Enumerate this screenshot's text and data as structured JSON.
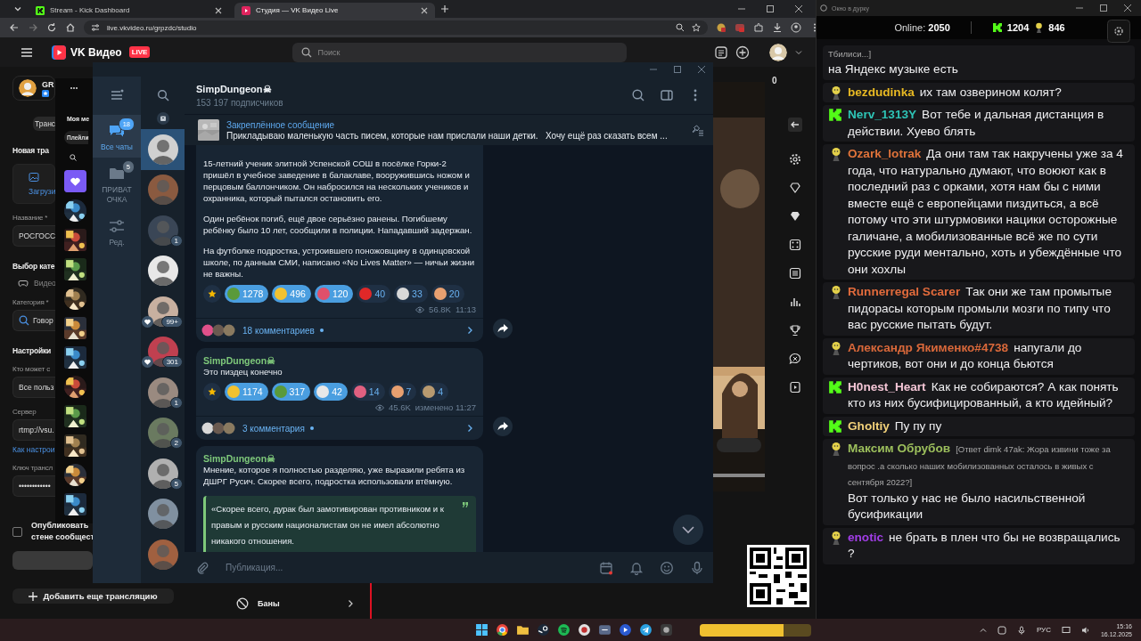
{
  "browser": {
    "tabs": [
      {
        "label": "Stream - Kick Dashboard",
        "selected": false
      },
      {
        "label": "Студия — VK Видео Live",
        "selected": true
      }
    ],
    "url": "live.vkvideo.ru/grpzdc/studio",
    "brand": "VK Видео",
    "brand_badge": "LIVE",
    "search_placeholder": "Поиск"
  },
  "studio": {
    "channel": "GR",
    "tab": "Транс",
    "heading": "Новая тра",
    "upload": "Загрузи",
    "title_label": "Название *",
    "title_value": "РОСГОСС",
    "category_heading": "Выбор кате",
    "category_type": "Видео",
    "category_label": "Категория *",
    "category_value": "Говор",
    "settings_heading": "Настройки",
    "access_label": "Кто может с",
    "access_value": "Все польз",
    "server_label": "Сервер",
    "server_value": "rtmp://vsu.",
    "help_link": "Как настрои",
    "key_label": "Ключ трансл",
    "key_value": "••••••••••••",
    "publish": {
      "lines": [
        "Опубликовать",
        "стене сообщест"
      ],
      "checked": false
    },
    "add_stream": "Добавить еще трансляцию",
    "bans": "Баны"
  },
  "music": {
    "heading": "Моя ме",
    "filter": "Плейли",
    "covers": [
      {
        "kind": "favorites"
      },
      {
        "kind": "picture"
      },
      {
        "kind": "picture"
      },
      {
        "kind": "picture"
      },
      {
        "kind": "picture"
      },
      {
        "kind": "picture"
      },
      {
        "kind": "picture"
      },
      {
        "kind": "picture"
      },
      {
        "kind": "picture"
      },
      {
        "kind": "picture"
      },
      {
        "kind": "picture"
      },
      {
        "kind": "picture"
      }
    ]
  },
  "side_rail": {
    "count": "0"
  },
  "telegram": {
    "channel": "SimpDungeon☠",
    "subscribers": "153 197 подписчиков",
    "folders": [
      {
        "kind": "folder",
        "label": "Все чаты",
        "badge": "18",
        "selected": true
      },
      {
        "kind": "folder",
        "label": "ПРИВАТ ОЧКА",
        "badge": "5",
        "selected": false
      },
      {
        "kind": "edit",
        "label": "Ред.",
        "selected": false
      }
    ],
    "chats": [
      {
        "selected": true,
        "reaction": false
      },
      {
        "selected": false,
        "reaction": false
      },
      {
        "selected": false,
        "reaction": false,
        "badge": "1"
      },
      {
        "selected": false,
        "reaction": false
      },
      {
        "selected": false,
        "reaction": true,
        "badge": "99+"
      },
      {
        "selected": false,
        "reaction": true,
        "badge": "301"
      },
      {
        "selected": false,
        "reaction": false,
        "badge": "1"
      },
      {
        "selected": false,
        "reaction": false,
        "badge": "2"
      },
      {
        "selected": false,
        "reaction": false,
        "badge": "5"
      },
      {
        "selected": false,
        "reaction": false
      },
      {
        "selected": false,
        "reaction": false
      }
    ],
    "pinned": {
      "title": "Закреплённое сообщение",
      "text": "Прикладываю маленькую часть писем, которые нам прислали наши детки.   Хочу ещё раз сказать всем ..."
    },
    "posts": [
      {
        "paragraphs": [
          "15-летний ученик элитной Успенской СОШ в посёлке Горки-2 пришёл в учебное заведение в балаклаве, вооружившись ножом и перцовым баллончиком. Он набросился на нескольких учеников и охранника, который пытался остановить его.",
          "Один ребёнок погиб, ещё двое серьёзно ранены. Погибшему ребёнку было 10 лет, сообщили в полиции. Нападавший задержан.",
          "На футболке подростка, устроившего поножовщину в одинцовской школе, по данным СМИ, написано «No Lives Matter» — ничьи жизни не важны."
        ],
        "reactions": [
          {
            "count": "1278",
            "color": "#5a9a3a",
            "selected": true
          },
          {
            "count": "496",
            "color": "#f2c230",
            "selected": true
          },
          {
            "count": "120",
            "color": "#e0506a",
            "selected": true
          },
          {
            "count": "40",
            "color": "#e02828",
            "selected": false
          },
          {
            "count": "33",
            "color": "#d8d8d8",
            "selected": false
          },
          {
            "count": "20",
            "color": "#e8a070",
            "selected": false
          }
        ],
        "views": "56.8K",
        "time": "11:13",
        "comments": "18 комментариев"
      },
      {
        "author": "SimpDungeon☠",
        "paragraphs": [
          "Это пиздец конечно"
        ],
        "reactions": [
          {
            "count": "1174",
            "color": "#f2c230",
            "selected": true
          },
          {
            "count": "317",
            "color": "#5a9a3a",
            "selected": true
          },
          {
            "count": "42",
            "color": "#e8e8e8",
            "selected": true
          },
          {
            "count": "14",
            "color": "#e06080",
            "selected": false
          },
          {
            "count": "7",
            "color": "#e8a070",
            "selected": false
          },
          {
            "count": "4",
            "color": "#b89a70",
            "selected": false
          }
        ],
        "views": "45.6K",
        "time": "изменено 11:27",
        "comments": "3 комментария"
      },
      {
        "author": "SimpDungeon☠",
        "paragraphs": [
          "Мнение, которое я полностью разделяю, уже выразили ребята из ДШРГ Русич. Скорее всего, подростка использовали втёмную."
        ],
        "quote": "«Скорее всего, дурак был замотивирован противником и к правым и русским националистам он не имел абсолютно никакого отношения."
      }
    ],
    "composer_placeholder": "Публикация..."
  },
  "chat": {
    "title": "Окно в дурку",
    "online_label": "Online:",
    "online": "2050",
    "kick_count": "1204",
    "vk_count": "846",
    "messages": [
      {
        "reply": "Тбилиси...]",
        "text": "на Яндекс музыке есть"
      },
      {
        "kind": "vk",
        "author": "bezdudinka",
        "color": "#e8b923",
        "text": "их там озверином колят?"
      },
      {
        "kind": "kick",
        "author": "Nerv_1313Y",
        "color": "#2ec4b6",
        "text": "Вот тебе и дальная дистанция в действии. Хуево блять"
      },
      {
        "kind": "vk",
        "author": "Ozark_lotrak",
        "color": "#e0733a",
        "text": "Да они там так накручены уже за 4 года, что натурально думают, что воюют как в последний раз с орками, хотя нам бы с ними вместе ещё с европейцами пиздиться, а всё потому что эти штурмовики нацики осторожные галичане, а мобилизованные всё же по сути русские руди ментально, хоть и убеждённые что они хохлы"
      },
      {
        "kind": "vk",
        "author": "Runnerregal Scarer",
        "color": "#e26b3c",
        "text": "Так они же там промытые пидорасы которым промыли мозги по типу что вас русские пытать будут."
      },
      {
        "kind": "vk",
        "author": "Александр Якименко#4738",
        "color": "#d9683a",
        "text": "напугали до чертиков, вот они и до конца бьются"
      },
      {
        "kind": "kick",
        "author": "H0nest_Heart",
        "color": "#f4c6d6",
        "text": "Как не собираются? А как понять кто из них бусифицированный, а кто идейный?"
      },
      {
        "kind": "kick",
        "author": "Gholtiy",
        "color": "#f3d27a",
        "text": "Пу пу пу"
      },
      {
        "kind": "vk",
        "author": "Максим Обрубов",
        "color": "#9cbf5c",
        "reply": "[Ответ dimk 47ak: Жора извини тоже за вопрос .а сколько наших мобилизованных осталось в живых с сентября 2022?]",
        "text": "Вот только у нас не было насильственной бусификации"
      },
      {
        "kind": "vk",
        "author": "enotic",
        "color": "#a23ee8",
        "text": "не брать в плен что бы не возвращались ?"
      }
    ]
  },
  "taskbar": {
    "level": 0.75,
    "language": "РУС",
    "time": "15:16",
    "date": "16.12.2025"
  }
}
